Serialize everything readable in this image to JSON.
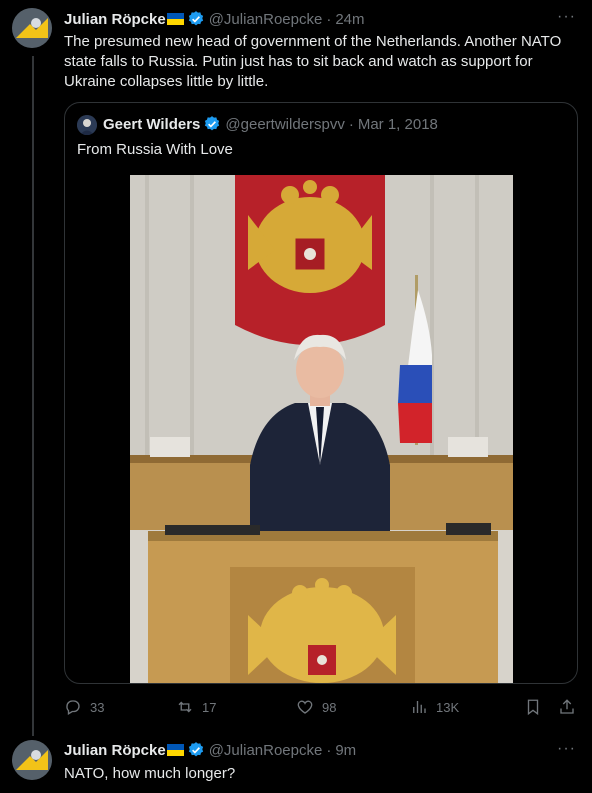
{
  "tweet1": {
    "author_name": "Julian Röpcke",
    "handle": "@JulianRoepcke",
    "sep": "·",
    "time": "24m",
    "text": "The presumed new head of government of the Netherlands. Another NATO state falls to Russia. Putin just has to sit back and watch as support for Ukraine collapses little by little.",
    "more_icon": "more-icon",
    "quote": {
      "author_name": "Geert Wilders",
      "handle": "@geertwilderspvv",
      "sep": "·",
      "date": "Mar 1, 2018",
      "text": "From Russia With Love"
    },
    "actions": {
      "reply_count": "33",
      "repost_count": "17",
      "like_count": "98",
      "views_count": "13K"
    }
  },
  "tweet2": {
    "author_name": "Julian Röpcke",
    "handle": "@JulianRoepcke",
    "sep": "·",
    "time": "9m",
    "text": "NATO, how much longer?"
  },
  "colors": {
    "background": "#000000",
    "text": "#e7e9ea",
    "muted": "#71767b",
    "verified": "#1d9bf0",
    "border": "#2f3336"
  }
}
